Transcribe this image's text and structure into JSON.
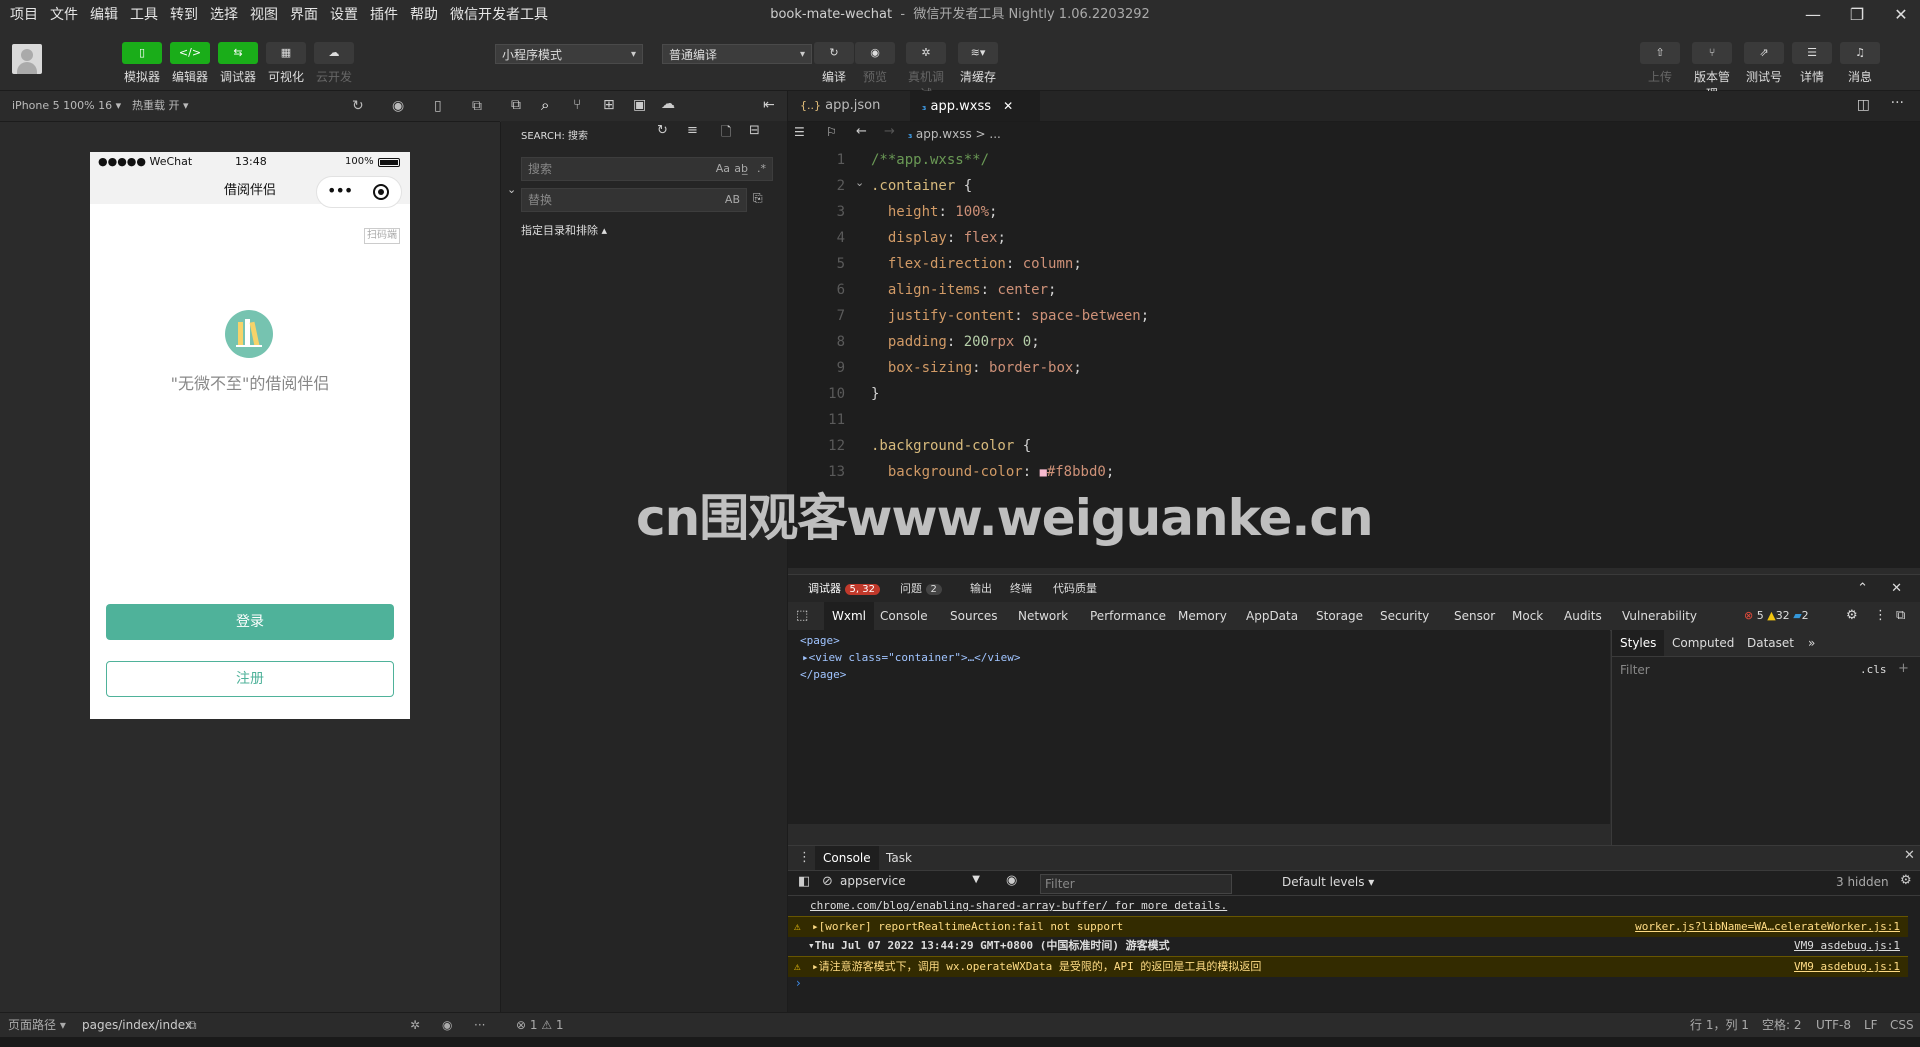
{
  "menubar": {
    "menus": [
      "项目",
      "文件",
      "编辑",
      "工具",
      "转到",
      "选择",
      "视图",
      "界面",
      "设置",
      "插件",
      "帮助",
      "微信开发者工具"
    ],
    "project": "book-mate-wechat",
    "app_title": "微信开发者工具 Nightly 1.06.2203292"
  },
  "toolbar": {
    "left_buttons": [
      "模拟器",
      "编辑器",
      "调试器",
      "可视化",
      "云开发"
    ],
    "mode_select": "小程序模式",
    "compile_select": "普通编译",
    "mid_buttons": [
      "编译",
      "预览",
      "真机调试",
      "清缓存"
    ],
    "right_buttons": [
      "上传",
      "版本管理",
      "测试号",
      "详情",
      "消息"
    ]
  },
  "simulator": {
    "device": "iPhone 5 100% 16",
    "hot_reload": "热重载 开",
    "status_carrier": "●●●●● WeChat",
    "status_time": "13:48",
    "status_battery": "100%",
    "nav_title": "借阅伴侣",
    "scan_label": "扫码端",
    "slogan": "\"无微不至\"的借阅伴侣",
    "login_label": "登录",
    "register_label": "注册"
  },
  "search": {
    "header": "SEARCH: 搜索",
    "search_placeholder": "搜索",
    "replace_placeholder": "替换",
    "include_exclude": "指定目录和排除 ▴",
    "opt_case": "Aa",
    "opt_word": "ab̲",
    "opt_regex": ".*",
    "opt_preserve": "AB"
  },
  "editor": {
    "tabs": [
      {
        "icon": "{..}",
        "label": "app.json"
      },
      {
        "icon": "css",
        "label": "app.wxss"
      }
    ],
    "breadcrumb": "app.wxss > ...",
    "lines": [
      {
        "n": "1",
        "parts": [
          [
            "comment",
            "/**app.wxss**/"
          ]
        ]
      },
      {
        "n": "2",
        "parts": [
          [
            "sel",
            ".container"
          ],
          [
            "punc",
            " {"
          ]
        ]
      },
      {
        "n": "3",
        "parts": [
          [
            "punc",
            "  "
          ],
          [
            "prop",
            "height"
          ],
          [
            "punc",
            ": "
          ],
          [
            "val",
            "100%"
          ],
          [
            "punc",
            ";"
          ]
        ]
      },
      {
        "n": "4",
        "parts": [
          [
            "punc",
            "  "
          ],
          [
            "prop",
            "display"
          ],
          [
            "punc",
            ": "
          ],
          [
            "val",
            "flex"
          ],
          [
            "punc",
            ";"
          ]
        ]
      },
      {
        "n": "5",
        "parts": [
          [
            "punc",
            "  "
          ],
          [
            "prop",
            "flex-direction"
          ],
          [
            "punc",
            ": "
          ],
          [
            "val",
            "column"
          ],
          [
            "punc",
            ";"
          ]
        ]
      },
      {
        "n": "6",
        "parts": [
          [
            "punc",
            "  "
          ],
          [
            "prop",
            "align-items"
          ],
          [
            "punc",
            ": "
          ],
          [
            "val",
            "center"
          ],
          [
            "punc",
            ";"
          ]
        ]
      },
      {
        "n": "7",
        "parts": [
          [
            "punc",
            "  "
          ],
          [
            "prop",
            "justify-content"
          ],
          [
            "punc",
            ": "
          ],
          [
            "val",
            "space-between"
          ],
          [
            "punc",
            ";"
          ]
        ]
      },
      {
        "n": "8",
        "parts": [
          [
            "punc",
            "  "
          ],
          [
            "prop",
            "padding"
          ],
          [
            "punc",
            ": "
          ],
          [
            "num",
            "200"
          ],
          [
            "val",
            "rpx "
          ],
          [
            "num",
            "0"
          ],
          [
            "punc",
            ";"
          ]
        ]
      },
      {
        "n": "9",
        "parts": [
          [
            "punc",
            "  "
          ],
          [
            "prop",
            "box-sizing"
          ],
          [
            "punc",
            ": "
          ],
          [
            "val",
            "border-box"
          ],
          [
            "punc",
            ";"
          ]
        ]
      },
      {
        "n": "10",
        "parts": [
          [
            "punc",
            "}"
          ]
        ]
      },
      {
        "n": "11",
        "parts": [
          [
            "punc",
            ""
          ]
        ]
      },
      {
        "n": "12",
        "parts": [
          [
            "sel",
            ".background-color"
          ],
          [
            "punc",
            " {"
          ]
        ]
      },
      {
        "n": "13",
        "parts": [
          [
            "punc",
            "  "
          ],
          [
            "prop",
            "background-color"
          ],
          [
            "punc",
            ": "
          ],
          [
            "swatch",
            "■"
          ],
          [
            "val",
            "#f8bbd0"
          ],
          [
            "punc",
            ";"
          ]
        ]
      }
    ],
    "swatch_color": "#f8bbd0"
  },
  "watermark": "cn围观客www.weiguanke.cn",
  "debugger": {
    "tabs": [
      "调试器",
      "问题",
      "输出",
      "终端",
      "代码质量"
    ],
    "debugger_badge": "5, 32",
    "issues_badge": "2",
    "devtools_tabs": [
      "Wxml",
      "Console",
      "Sources",
      "Network",
      "Performance",
      "Memory",
      "AppData",
      "Storage",
      "Security",
      "Sensor",
      "Mock",
      "Audits",
      "Vulnerability"
    ],
    "error_count": "5",
    "warn_count": "32",
    "info_count": "2",
    "wxml_lines": [
      "<page>",
      "▸<view class=\"container\">…</view>",
      "</page>"
    ],
    "styles_tabs": [
      "Styles",
      "Computed",
      "Dataset"
    ],
    "styles_filter": "Filter",
    "cls_label": ".cls",
    "drawer_tabs": [
      "Console",
      "Task"
    ],
    "context": "appservice",
    "console_filter": "Filter",
    "levels": "Default levels ▾",
    "hidden": "3 hidden",
    "logs": [
      {
        "kind": "info",
        "text": "chrome.com/blog/enabling-shared-array-buffer/ for more details.",
        "src": ""
      },
      {
        "kind": "warn",
        "text": "▸[worker] reportRealtimeAction:fail not support",
        "src": "worker.js?libName=WA…celerateWorker.js:1"
      },
      {
        "kind": "group",
        "text": "▾Thu Jul 07 2022 13:44:29 GMT+0800 (中国标准时间) 游客模式",
        "src": "VM9 asdebug.js:1"
      },
      {
        "kind": "warn",
        "text": "▸请注意游客模式下，调用 wx.operateWXData 是受限的，API 的返回是工具的模拟返回",
        "src": "VM9 asdebug.js:1"
      }
    ],
    "prompt": "›"
  },
  "statusbar": {
    "page_path_label": "页面路径 ▾",
    "page_path": "pages/index/index",
    "problems": "⊗ 1 ⚠ 1",
    "position": "行 1，列 1",
    "spaces": "空格: 2",
    "encoding": "UTF-8",
    "eol": "LF",
    "lang": "CSS"
  },
  "colors": {
    "accent_green": "#1aad19",
    "teal": "#4fb29a"
  }
}
